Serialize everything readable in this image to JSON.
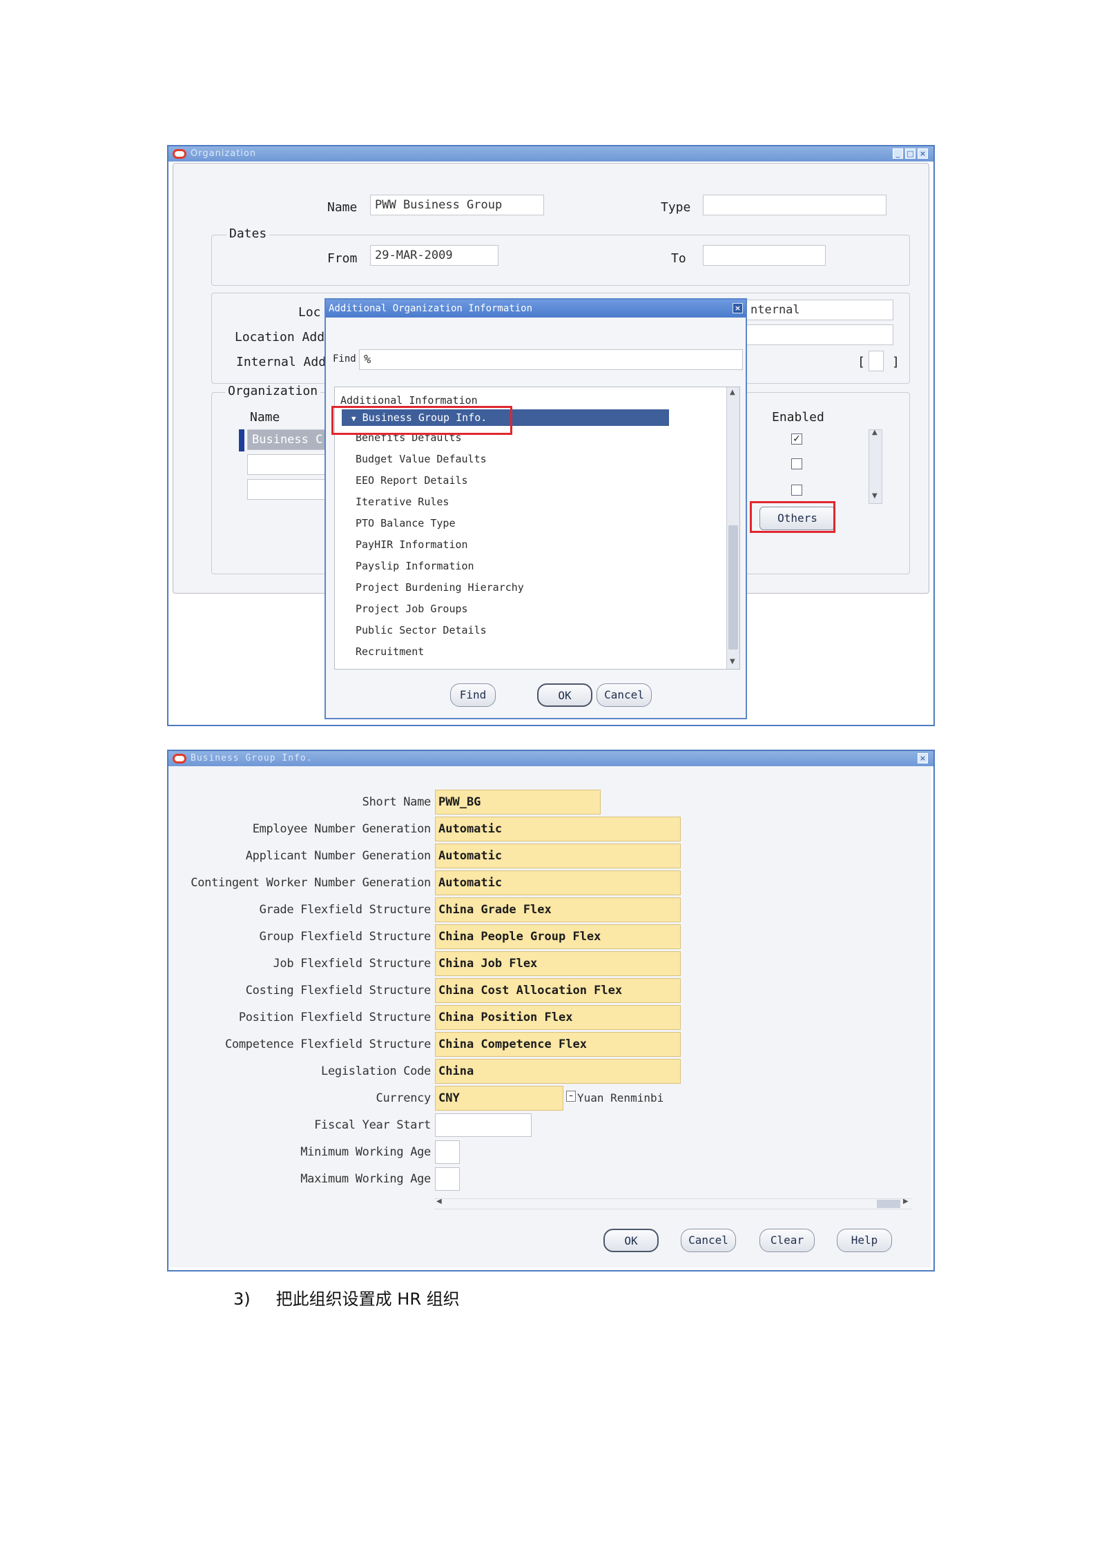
{
  "org_window": {
    "name_label": "Name",
    "name_value": "PWW Business Group",
    "type_label": "Type",
    "dates_label": "Dates",
    "from_label": "From",
    "from_value": "29-MAR-2009",
    "to_label": "To",
    "location_label": "Loc",
    "location_address_label": "Location Add",
    "internal_address_label": "Internal Add",
    "internal_value": "nternal",
    "org_classification_label": "Organization",
    "col_name_label": "Name",
    "row1_name": "Business C",
    "enabled_label": "Enabled",
    "others_button": "Others",
    "bracket_left": "[",
    "bracket_right": "]"
  },
  "dialog": {
    "title": "Additional Organization Information",
    "find_label": "Find",
    "find_value": "%",
    "header": "Additional Information",
    "items": [
      "Business Group Info.",
      "Benefits Defaults",
      "Budget Value Defaults",
      "EEO Report Details",
      "Iterative Rules",
      "PTO Balance Type",
      "PayHIR Information",
      "Payslip Information",
      "Project Burdening Hierarchy",
      "Project Job Groups",
      "Public Sector Details",
      "Recruitment"
    ],
    "find_button": "Find",
    "ok_button": "OK",
    "cancel_button": "Cancel"
  },
  "bg_window": {
    "title": "Business Group Info.",
    "fields": [
      {
        "label": "Short Name",
        "value": "PWW_BG"
      },
      {
        "label": "Employee Number Generation",
        "value": "Automatic"
      },
      {
        "label": "Applicant Number Generation",
        "value": "Automatic"
      },
      {
        "label": "Contingent Worker Number Generation",
        "value": "Automatic"
      },
      {
        "label": "Grade Flexfield Structure",
        "value": "China Grade Flex"
      },
      {
        "label": "Group Flexfield Structure",
        "value": "China People Group Flex"
      },
      {
        "label": "Job Flexfield Structure",
        "value": "China Job Flex"
      },
      {
        "label": "Costing Flexfield Structure",
        "value": "China Cost Allocation Flex"
      },
      {
        "label": "Position Flexfield Structure",
        "value": "China Position Flex"
      },
      {
        "label": "Competence Flexfield Structure",
        "value": "China Competence Flex"
      },
      {
        "label": "Legislation Code",
        "value": "China"
      },
      {
        "label": "Currency",
        "value": "CNY"
      },
      {
        "label": "Fiscal Year Start",
        "value": ""
      },
      {
        "label": "Minimum Working Age",
        "value": ""
      },
      {
        "label": "Maximum Working Age",
        "value": ""
      }
    ],
    "currency_desc": "Yuan Renminbi",
    "ok_button": "OK",
    "cancel_button": "Cancel",
    "clear_button": "Clear",
    "help_button": "Help"
  },
  "caption": {
    "number": "3)",
    "text": "把此组织设置成 HR 组织"
  },
  "colors": {
    "frame_border": "#4e7bc1",
    "highlight_red": "#e0272e",
    "field_yellow": "#fbe7a6",
    "selection_blue": "#3e5f9a"
  }
}
